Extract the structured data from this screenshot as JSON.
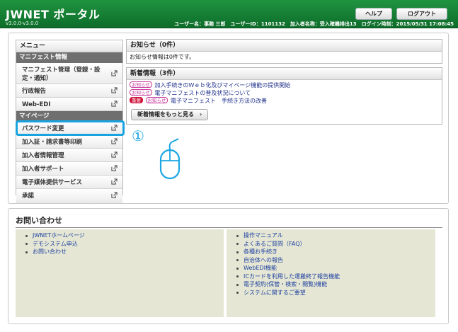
{
  "header": {
    "title": "JWNET ポータル",
    "version": "v3.0.0-v3.0.0",
    "help_label": "ヘルプ",
    "logout_label": "ログアウト",
    "user_info": "ユーザー名：事務 三郎　ユーザーID：1101132　加入者名称：受入確機排出13　ログイン時刻：2015/05/31 17:08:45"
  },
  "menu": {
    "title": "メニュー",
    "section_manifest": "マニフェスト情報",
    "items_manifest": [
      "マニフェスト管理（登録・設定・通知）",
      "行政報告",
      "Web-EDI"
    ],
    "section_mypage": "マイページ",
    "items_mypage": [
      "パスワード変更",
      "加入証・請求書等印刷",
      "加入者情報管理",
      "加入者サポート",
      "電子媒体提供サービス",
      "承諾"
    ]
  },
  "annotation": {
    "step_number": "①"
  },
  "notice": {
    "title": "お知らせ（0件）",
    "body": "お知らせ情報は0件です。"
  },
  "news": {
    "title": "新着情報（3件）",
    "tag_notice": "お知らせ",
    "tag_important": "重要",
    "items": [
      "加入手続きのＷｅｂ化及びマイページ機能の提供開始",
      "電子マニフェストの普及状況について",
      "電子マニフェスト　手続き方法の改善"
    ],
    "more_label": "新着情報をもっと見る　›"
  },
  "contact": {
    "title": "お問い合わせ",
    "left": [
      "JWNETホームページ",
      "デモシステム申込",
      "お問い合わせ"
    ],
    "right": [
      "操作マニュアル",
      "よくあるご質問（FAQ）",
      "各種お手続き",
      "自治体への報告",
      "WebEDI機能",
      "ICカードを利用した運搬終了報告機能",
      "電子契約(保管・検索・閲覧)機能",
      "システムに関するご要望"
    ]
  },
  "colors": {
    "header_green": "#1f9440",
    "highlight_blue": "#18a4e0",
    "tag_magenta": "#c7399d",
    "tag_important_red": "#d0113b",
    "contact_bg": "#e5e7d4"
  }
}
